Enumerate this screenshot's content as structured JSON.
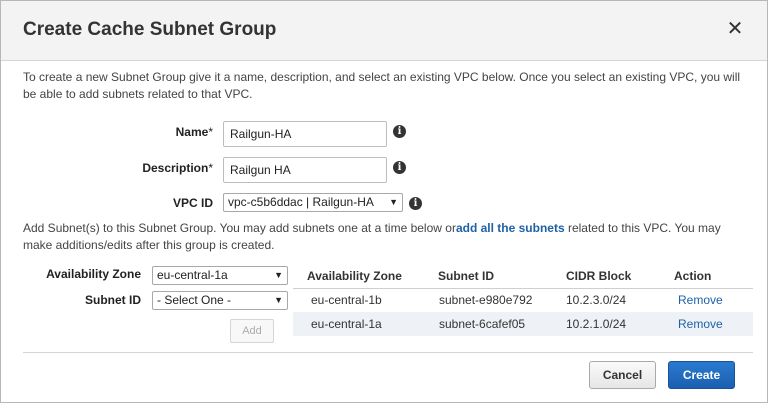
{
  "dialog": {
    "title": "Create Cache Subnet Group",
    "close_glyph": "✕",
    "intro": "To create a new Subnet Group give it a name, description, and select an existing VPC below. Once you select an existing VPC, you will be able to add subnets related to that VPC."
  },
  "form": {
    "name_label": "Name",
    "name_value": "Railgun-HA",
    "description_label": "Description",
    "description_value": "Railgun HA",
    "vpc_label": "VPC ID",
    "vpc_value": "vpc-c5b6ddac | Railgun-HA",
    "required_mark": "*"
  },
  "subnets": {
    "text_before": "Add Subnet(s) to this Subnet Group. You may add subnets one at a time below or",
    "link_text": "add all the subnets",
    "text_after": " related to this VPC. You may make additions/edits after this group is created.",
    "az_label": "Availability Zone",
    "az_value": "eu-central-1a",
    "subnet_label": "Subnet ID",
    "subnet_value": "- Select One -",
    "add_label": "Add"
  },
  "table": {
    "headers": [
      "Availability Zone",
      "Subnet ID",
      "CIDR Block",
      "Action"
    ],
    "rows": [
      {
        "az": "eu-central-1b",
        "subnet": "subnet-e980e792",
        "cidr": "10.2.3.0/24",
        "action": "Remove"
      },
      {
        "az": "eu-central-1a",
        "subnet": "subnet-6cafef05",
        "cidr": "10.2.1.0/24",
        "action": "Remove"
      }
    ]
  },
  "footer": {
    "cancel_label": "Cancel",
    "create_label": "Create"
  },
  "icons": {
    "info": "i",
    "dropdown": "▼"
  },
  "colors": {
    "primary": "#1f61a8",
    "header_bg": "#f3f3f3"
  }
}
